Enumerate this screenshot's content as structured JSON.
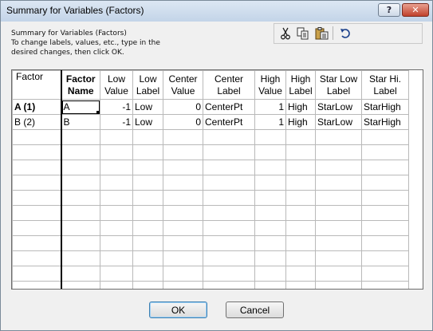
{
  "window": {
    "title": "Summary for Variables (Factors)",
    "help_label": "?",
    "close_label": "✕"
  },
  "instructions": {
    "lines": [
      "Summary for Variables (Factors)",
      "To change labels, values, etc., type in the",
      "desired changes, then click OK."
    ]
  },
  "toolbar": {
    "icons": [
      "cut-icon",
      "copy-icon",
      "paste-icon",
      "undo-icon"
    ]
  },
  "grid": {
    "corner_header": "Factor",
    "headers": [
      {
        "l1": "Factor",
        "l2": "Name"
      },
      {
        "l1": "Low",
        "l2": "Value"
      },
      {
        "l1": "Low",
        "l2": "Label"
      },
      {
        "l1": "Center",
        "l2": "Value"
      },
      {
        "l1": "Center",
        "l2": "Label"
      },
      {
        "l1": "High",
        "l2": "Value"
      },
      {
        "l1": "High",
        "l2": "Label"
      },
      {
        "l1": "Star Low",
        "l2": "Label"
      },
      {
        "l1": "Star Hi.",
        "l2": "Label"
      }
    ],
    "rows": [
      {
        "factor": "A  (1)",
        "name": "A",
        "low_value": "-1",
        "low_label": "Low",
        "center_value": "0",
        "center_label": "CenterPt",
        "high_value": "1",
        "high_label": "High",
        "star_low": "StarLow",
        "star_hi": "StarHigh"
      },
      {
        "factor": "B  (2)",
        "name": "B",
        "low_value": "-1",
        "low_label": "Low",
        "center_value": "0",
        "center_label": "CenterPt",
        "high_value": "1",
        "high_label": "High",
        "star_low": "StarLow",
        "star_hi": "StarHigh"
      }
    ]
  },
  "buttons": {
    "ok_label": "OK",
    "cancel_label": "Cancel"
  }
}
